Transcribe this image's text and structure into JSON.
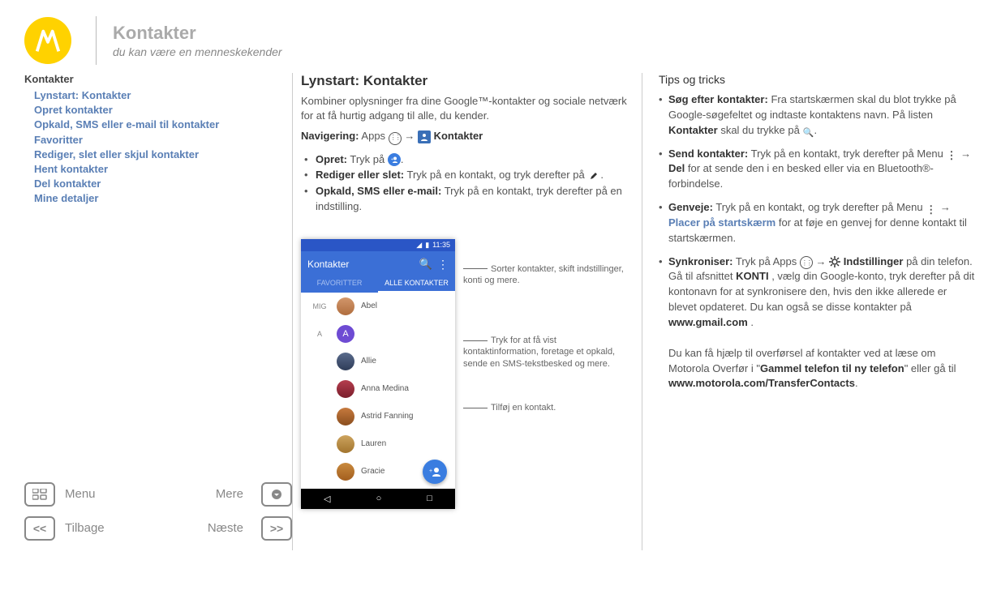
{
  "header": {
    "title": "Kontakter",
    "subtitle": "du kan være en menneskekender"
  },
  "sidebar": {
    "title": "Kontakter",
    "items": [
      "Lynstart: Kontakter",
      "Opret kontakter",
      "Opkald, SMS eller e-mail til kontakter",
      "Favoritter",
      "Rediger, slet eller skjul kontakter",
      "Hent kontakter",
      "Del kontakter",
      "Mine detaljer"
    ]
  },
  "footer_nav": {
    "menu": "Menu",
    "more": "Mere",
    "back": "Tilbage",
    "next": "Næste"
  },
  "article": {
    "title": "Lynstart: Kontakter",
    "intro": "Kombiner oplysninger fra dine Google™-kontakter og sociale netværk for at få hurtig adgang til alle, du kender.",
    "nav_label": "Navigering:",
    "nav_apps": "Apps",
    "nav_arrow": "→",
    "nav_contacts": "Kontakter",
    "bullets": {
      "create_label": "Opret:",
      "create_text": "Tryk på",
      "edit_label": "Rediger eller slet:",
      "edit_text": "Tryk på en kontakt, og tryk derefter på",
      "call_label": "Opkald, SMS eller e-mail:",
      "call_text": "Tryk på en kontakt, tryk derefter på en indstilling."
    }
  },
  "phone": {
    "time": "11:35",
    "app_title": "Kontakter",
    "tab_fav": "FAVORITTER",
    "tab_all": "ALLE KONTAKTER",
    "section_mig": "MIG",
    "section_a": "A",
    "contacts": [
      "Abel",
      "A",
      "Allie",
      "Anna Medina",
      "Astrid Fanning",
      "Lauren",
      "Gracie"
    ]
  },
  "callouts": {
    "top": "Sorter kontakter, skift indstillinger, konti og mere.",
    "mid": "Tryk for at få vist kontaktinformation, foretage et opkald, sende en SMS-tekstbesked og mere.",
    "bottom": "Tilføj en kontakt."
  },
  "tips": {
    "title": "Tips og tricks",
    "items": [
      {
        "lead": "Søg efter kontakter:",
        "body1": "Fra startskærmen skal du blot trykke på Google-søgefeltet og indtaste kontaktens navn. På listen",
        "bold1": "Kontakter",
        "body2": "skal du trykke på"
      },
      {
        "lead": "Send kontakter:",
        "body1": "Tryk på en kontakt, tryk derefter på Menu",
        "arrow": "→",
        "bold1": "Del",
        "body2": "for at sende den i en besked eller via en Bluetooth®-forbindelse."
      },
      {
        "lead": "Genveje:",
        "body1": "Tryk på en kontakt, og tryk derefter på Menu",
        "arrow": "→",
        "link1": "Placer på startskærm",
        "body2": "for at føje en genvej for denne kontakt til startskærmen."
      },
      {
        "lead": "Synkroniser:",
        "body1": "Tryk på  Apps",
        "arrow": "→",
        "bold1": "Indstillinger",
        "body2": "på din telefon. Gå til afsnittet",
        "bold2": "KONTI",
        "body3": ", vælg din Google-konto, tryk derefter på dit kontonavn for at synkronisere den, hvis den ikke allerede er blevet opdateret. Du kan også se disse kontakter på",
        "bold3": "www.gmail.com",
        "body4": "."
      }
    ],
    "extra1": "Du kan få hjælp til overførsel af kontakter ved at læse om Motorola Overfør i \"",
    "extra_bold": "Gammel telefon til ny telefon",
    "extra2": "\" eller gå til",
    "extra_url": "www.motorola.com/TransferContacts",
    "extra3": "."
  }
}
